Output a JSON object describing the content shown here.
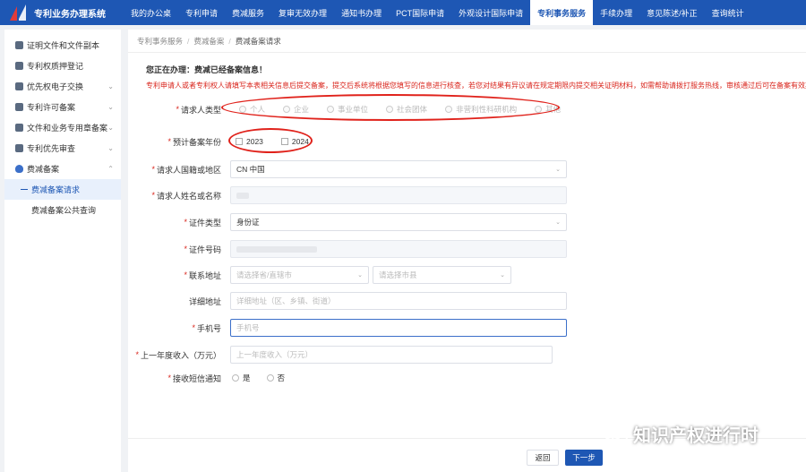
{
  "app": {
    "title": "专利业务办理系统"
  },
  "nav": [
    {
      "label": "我的办公桌",
      "active": false
    },
    {
      "label": "专利申请",
      "active": false
    },
    {
      "label": "费减服务",
      "active": false
    },
    {
      "label": "复审无效办理",
      "active": false
    },
    {
      "label": "通知书办理",
      "active": false
    },
    {
      "label": "PCT国际申请",
      "active": false
    },
    {
      "label": "外观设计国际申请",
      "active": false
    },
    {
      "label": "专利事务服务",
      "active": true
    },
    {
      "label": "手续办理",
      "active": false
    },
    {
      "label": "意见陈述/补正",
      "active": false
    },
    {
      "label": "查询统计",
      "active": false
    }
  ],
  "sidebar": {
    "items": [
      {
        "label": "证明文件和文件副本",
        "arrow": ""
      },
      {
        "label": "专利权质押登记",
        "arrow": ""
      },
      {
        "label": "优先权电子交换",
        "arrow": "⌄"
      },
      {
        "label": "专利许可备案",
        "arrow": "⌄"
      },
      {
        "label": "文件和业务专用章备案",
        "arrow": "⌄"
      },
      {
        "label": "专利优先审查",
        "arrow": "⌄"
      },
      {
        "label": "费减备案",
        "arrow": "⌃"
      }
    ],
    "sub_items": [
      {
        "label": "费减备案请求",
        "active": true
      },
      {
        "label": "费减备案公共查询",
        "active": false
      }
    ]
  },
  "breadcrumb": [
    "专利事务服务",
    "费减备案",
    "费减备案请求"
  ],
  "notice": {
    "title": "您正在办理：费减已经备案信息！",
    "text": "专利申请人或者专利权人请填写本表相关信息后提交备案，提交后系统将根据您填写的信息进行核查，若您对结果有异议请在规定期限内提交相关证明材料，如需帮助请拨打服务热线，审核通过后可在备案有效期内办理相关业务。"
  },
  "form": {
    "requester_type": {
      "label": "请求人类型",
      "options": [
        "个人",
        "企业",
        "事业单位",
        "社会团体",
        "非营利性科研机构",
        "其他"
      ]
    },
    "years": {
      "label": "预计备案年份",
      "options": [
        "2023",
        "2024"
      ]
    },
    "country": {
      "label": "请求人国籍或地区",
      "value": "CN 中国"
    },
    "name": {
      "label": "请求人姓名或名称"
    },
    "id_type": {
      "label": "证件类型",
      "value": "身份证"
    },
    "id_number": {
      "label": "证件号码"
    },
    "region": {
      "label": "联系地址",
      "placeholder1": "请选择省/直辖市",
      "placeholder2": "请选择市县"
    },
    "address": {
      "label": "详细地址",
      "placeholder": "详细地址（区、乡镇、街道）"
    },
    "phone": {
      "label": "手机号",
      "placeholder": "手机号"
    },
    "income": {
      "label": "上一年度收入（万元）",
      "placeholder": "上一年度收入（万元）"
    },
    "notify": {
      "label": "接收短信通知",
      "options": [
        "是",
        "否"
      ]
    }
  },
  "buttons": {
    "back": "返回",
    "next": "下一步"
  },
  "watermark": "知识产权进行时",
  "colors": {
    "primary": "#1e57b4",
    "alert": "#d9251c"
  }
}
